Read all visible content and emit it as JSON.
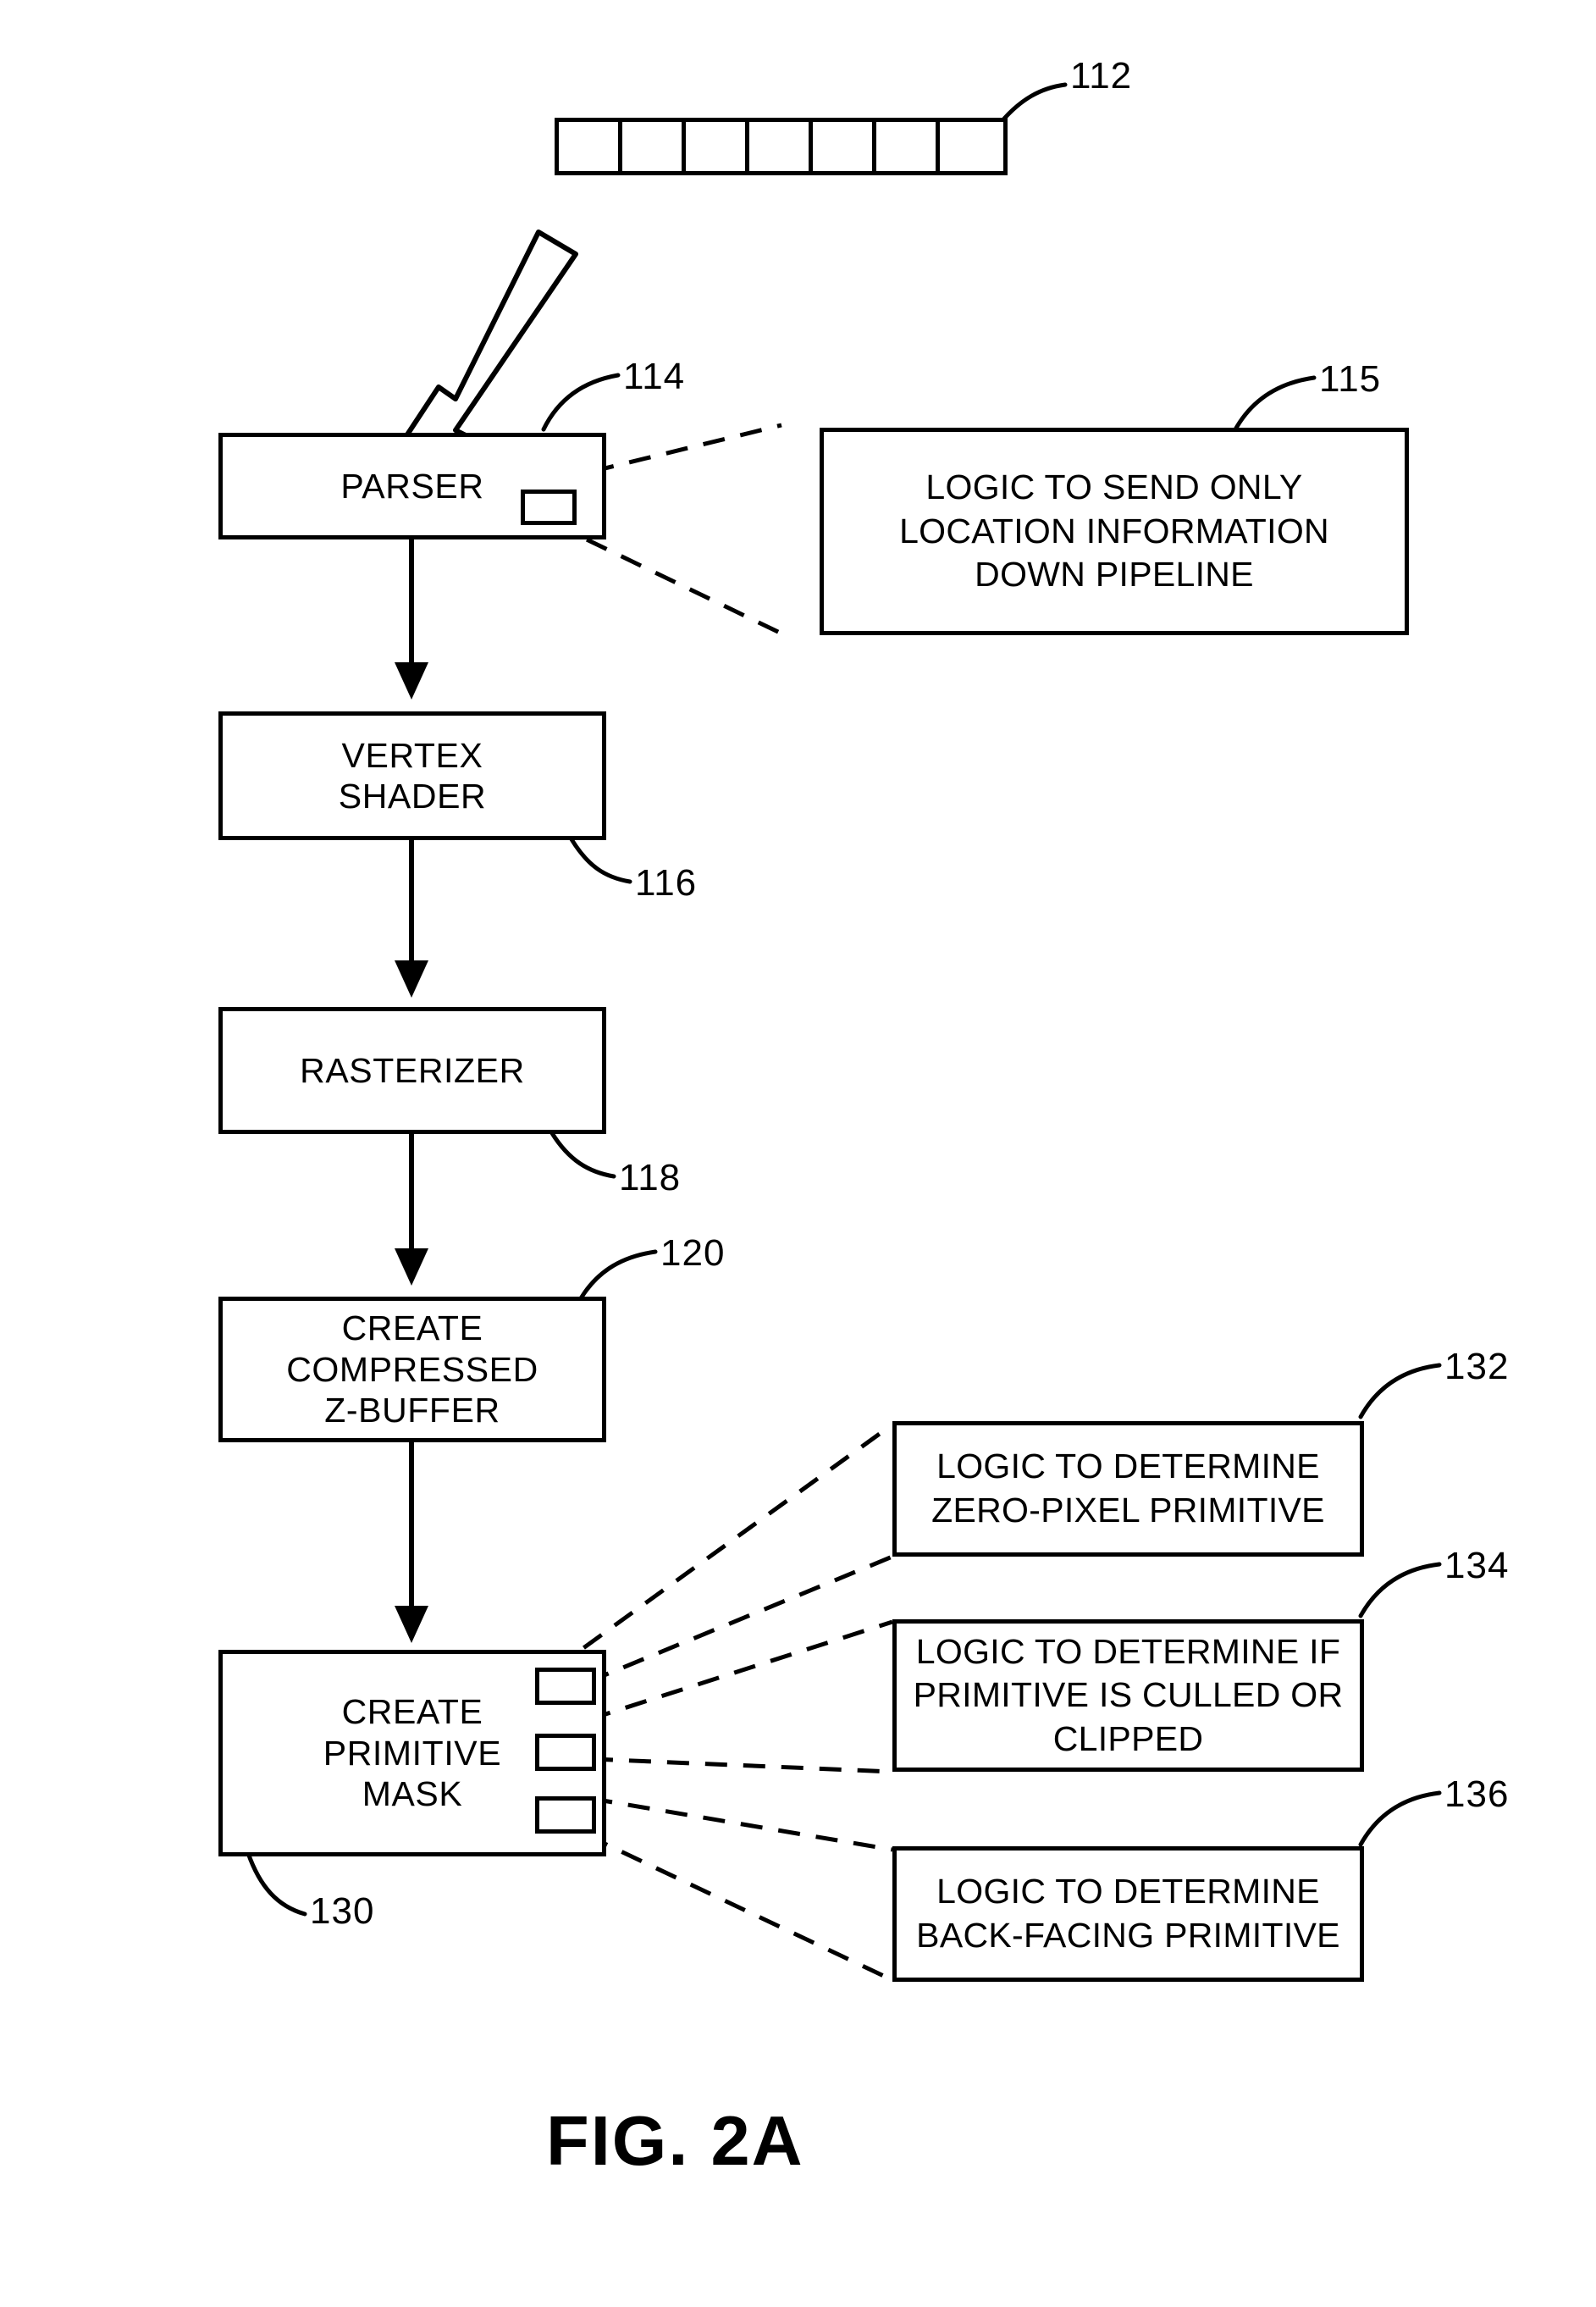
{
  "figure": {
    "caption": "FIG. 2A"
  },
  "buffer": {
    "ref": "112",
    "cell_count": 7,
    "cells": [
      "",
      "",
      "",
      "",
      "",
      "",
      ""
    ]
  },
  "pipeline": {
    "stages": [
      {
        "id": "parser",
        "label": "PARSER",
        "ref": "114"
      },
      {
        "id": "vertex",
        "label": "VERTEX\nSHADER",
        "ref": "116"
      },
      {
        "id": "rasterizer",
        "label": "RASTERIZER",
        "ref": "118"
      },
      {
        "id": "zbuffer",
        "label": "CREATE\nCOMPRESSED\nZ-BUFFER",
        "ref": "120"
      },
      {
        "id": "primmask",
        "label": "CREATE\nPRIMITIVE\nMASK",
        "ref": "130"
      }
    ]
  },
  "logic_boxes": [
    {
      "id": "send-location",
      "label": "LOGIC TO SEND ONLY\nLOCATION INFORMATION\nDOWN PIPELINE",
      "ref": "115"
    },
    {
      "id": "zero-pixel",
      "label": "LOGIC TO DETERMINE\nZERO-PIXEL PRIMITIVE",
      "ref": "132"
    },
    {
      "id": "culled-clipped",
      "label": "LOGIC TO DETERMINE IF\nPRIMITIVE IS CULLED OR\nCLIPPED",
      "ref": "134"
    },
    {
      "id": "back-facing",
      "label": "LOGIC TO DETERMINE\nBACK-FACING PRIMITIVE",
      "ref": "136"
    }
  ],
  "colors": {
    "ink": "#000000",
    "paper": "#ffffff"
  }
}
